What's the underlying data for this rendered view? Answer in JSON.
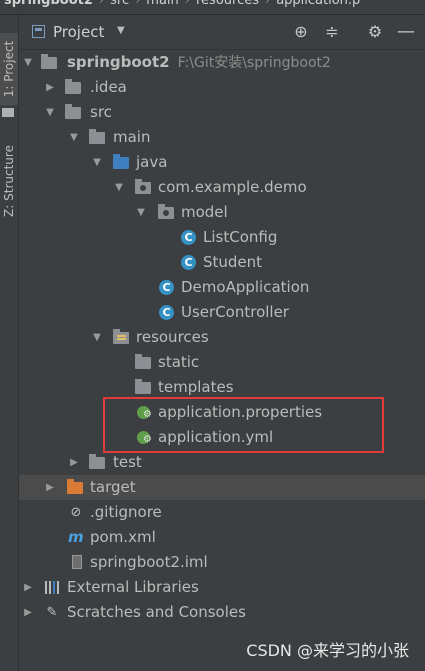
{
  "breadcrumb": {
    "items": [
      "springboot2",
      "src",
      "main",
      "resources",
      "application.p"
    ]
  },
  "side_tabs": {
    "project": "1: Project",
    "structure": "Z: Structure"
  },
  "header": {
    "title": "Project",
    "caret": "▼"
  },
  "toolbar": {
    "locate_icon": "⊕",
    "collapse_icon": "≑",
    "settings_icon": "⚙",
    "hide_icon": "—"
  },
  "tree": [
    {
      "label": "springboot2",
      "hint": "F:\\Git安装\\springboot2",
      "icon": "folder",
      "expanded": true,
      "bold": true
    },
    {
      "label": ".idea",
      "icon": "folder",
      "expanded": false
    },
    {
      "label": "src",
      "icon": "folder",
      "expanded": true
    },
    {
      "label": "main",
      "icon": "folder",
      "expanded": true
    },
    {
      "label": "java",
      "icon": "folder-blue",
      "expanded": true
    },
    {
      "label": "com.example.demo",
      "icon": "package",
      "expanded": true
    },
    {
      "label": "model",
      "icon": "package",
      "expanded": true
    },
    {
      "label": "ListConfig",
      "icon": "class"
    },
    {
      "label": "Student",
      "icon": "class"
    },
    {
      "label": "DemoApplication",
      "icon": "spring-class"
    },
    {
      "label": "UserController",
      "icon": "class"
    },
    {
      "label": "resources",
      "icon": "resources",
      "expanded": true
    },
    {
      "label": "static",
      "icon": "folder"
    },
    {
      "label": "templates",
      "icon": "folder"
    },
    {
      "label": "application.properties",
      "icon": "spring-config"
    },
    {
      "label": "application.yml",
      "icon": "spring-config"
    },
    {
      "label": "test",
      "icon": "folder",
      "expanded": false
    },
    {
      "label": "target",
      "icon": "folder-orange",
      "expanded": false,
      "selected": true
    },
    {
      "label": ".gitignore",
      "icon": "gitignore"
    },
    {
      "label": "pom.xml",
      "icon": "maven"
    },
    {
      "label": "springboot2.iml",
      "icon": "iml"
    },
    {
      "label": "External Libraries",
      "icon": "libraries",
      "expanded": false
    },
    {
      "label": "Scratches and Consoles",
      "icon": "scratches",
      "expanded": false
    }
  ],
  "watermark": "CSDN @来学习的小张",
  "colors": {
    "background": "#3c3f41",
    "selection": "#4b4b4b",
    "highlight_box": "#e03c3c",
    "folder_blue": "#3f7fbf",
    "folder_orange": "#d97a36",
    "class_icon": "#3592c4",
    "spring_icon": "#5f9f4a"
  }
}
